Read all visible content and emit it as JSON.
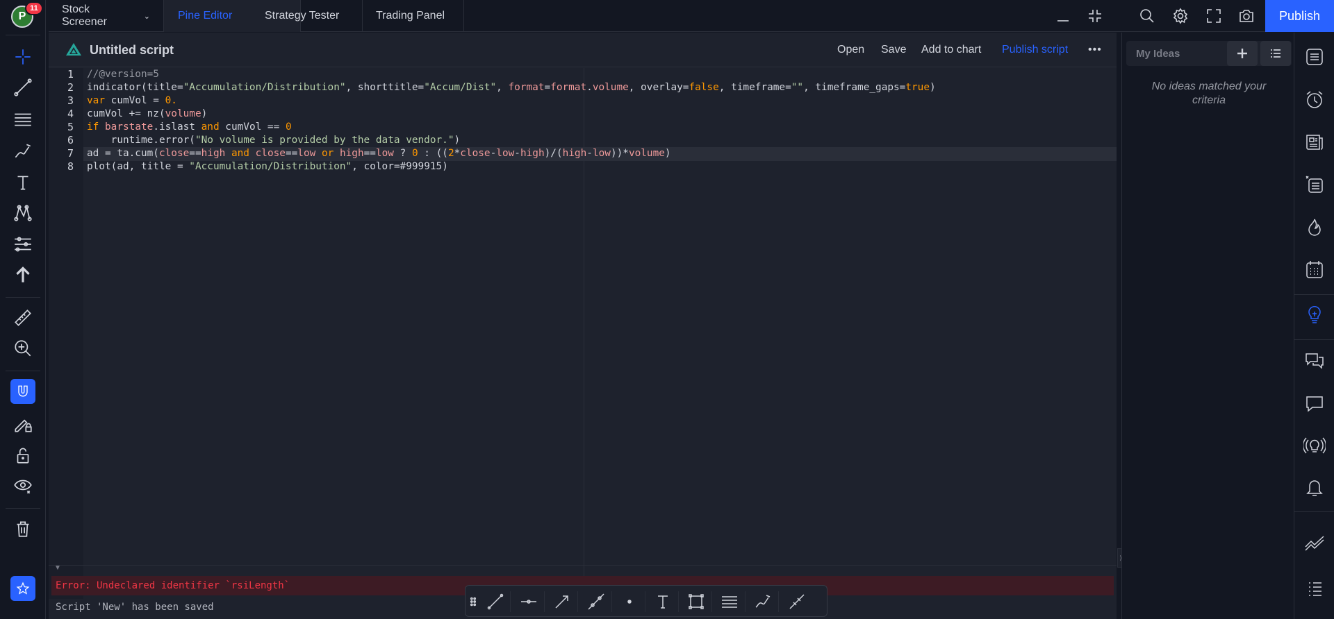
{
  "user": {
    "avatar_letter": "P",
    "notifications": "11"
  },
  "top_tabs": [
    {
      "label": "Stock Screener",
      "has_dropdown": true
    },
    {
      "label": "Pine Editor",
      "active": true
    },
    {
      "label": "Strategy Tester"
    },
    {
      "label": "Trading Panel"
    }
  ],
  "top_actions": {
    "publish_label": "Publish"
  },
  "editor": {
    "title": "Untitled script",
    "actions": {
      "open": "Open",
      "save": "Save",
      "add_to_chart": "Add to chart",
      "publish_script": "Publish script",
      "more": "•••"
    },
    "line_numbers": [
      "1",
      "2",
      "3",
      "4",
      "5",
      "6",
      "7",
      "8"
    ],
    "code_lines": [
      "//@version=5",
      "indicator(title=\"Accumulation/Distribution\", shorttitle=\"Accum/Dist\", format=format.volume, overlay=false, timeframe=\"\", timeframe_gaps=true)",
      "var cumVol = 0.",
      "cumVol += nz(volume)",
      "if barstate.islast and cumVol == 0",
      "    runtime.error(\"No volume is provided by the data vendor.\")",
      "ad = ta.cum(close==high and close==low or high==low ? 0 : ((2*close-low-high)/(high-low))*volume)",
      "plot(ad, title = \"Accumulation/Distribution\", color=#999915)"
    ],
    "current_line": "7",
    "error_message": "Error: Undeclared identifier `rsiLength`",
    "status_message": "Script 'New' has been saved"
  },
  "ideas": {
    "title": "My Ideas",
    "empty_message": "No ideas matched your criteria"
  },
  "colors": {
    "accent": "#2962ff",
    "error": "#f23645",
    "background": "#131722",
    "panel": "#1e222d"
  }
}
